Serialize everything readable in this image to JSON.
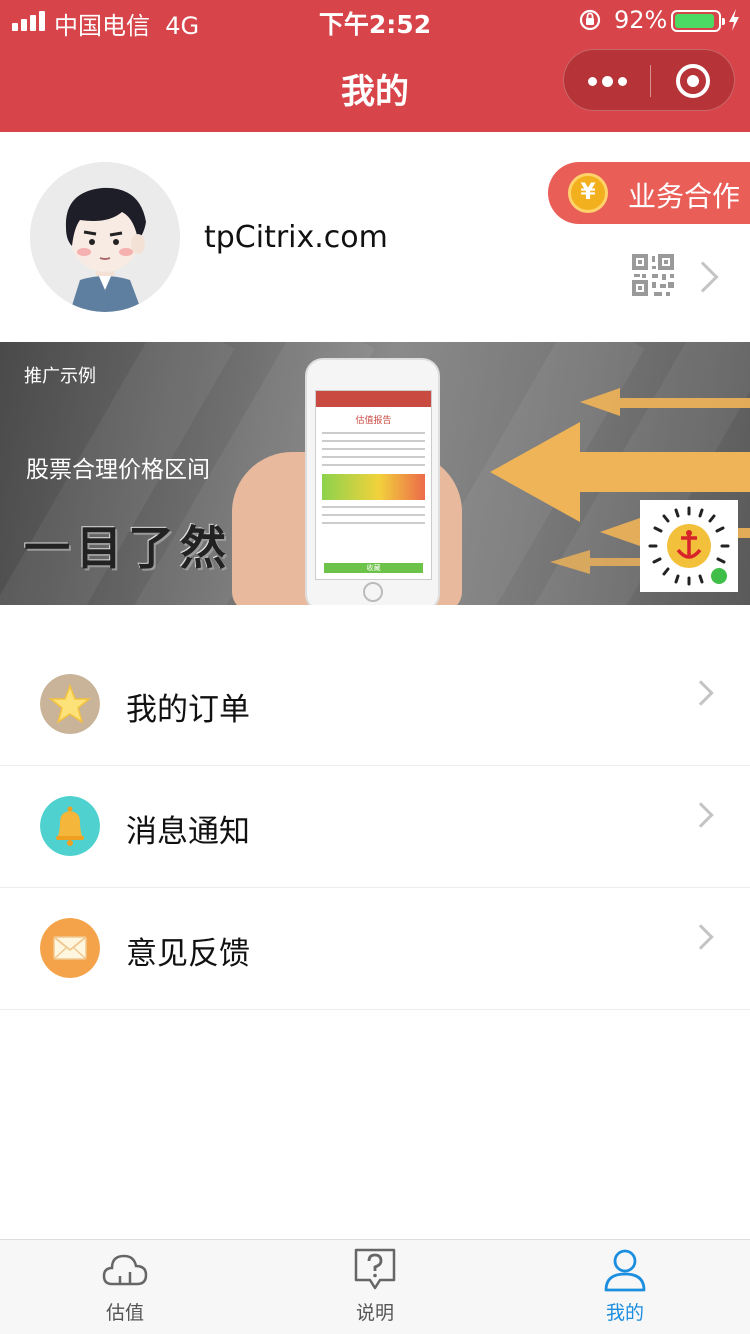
{
  "status_bar": {
    "carrier": "中国电信",
    "network": "4G",
    "time": "下午2:52",
    "battery_percent": "92%",
    "battery_level": 0.92
  },
  "nav": {
    "title": "我的",
    "background_color": "#d7444a"
  },
  "profile": {
    "username": "tpCitrix.com",
    "cooperation_label": "业务合作",
    "cooperation_icon_text": "¥"
  },
  "banner": {
    "tag": "推广示例",
    "line1": "股票合理价格区间",
    "line2": "一目了然",
    "phone_screen_title": "估值报告",
    "phone_button_label": "收藏"
  },
  "menu": [
    {
      "label": "我的订单",
      "icon": "star-icon",
      "icon_color": "#c9b49a"
    },
    {
      "label": "消息通知",
      "icon": "bell-icon",
      "icon_color": "#4fd1d0"
    },
    {
      "label": "意见反馈",
      "icon": "mail-icon",
      "icon_color": "#f5a34a"
    }
  ],
  "tabbar": {
    "tabs": [
      {
        "label": "估值",
        "icon": "cloud-icon"
      },
      {
        "label": "说明",
        "icon": "help-icon"
      },
      {
        "label": "我的",
        "icon": "user-icon"
      }
    ],
    "active_index": 2,
    "active_color": "#1c8ee0"
  }
}
